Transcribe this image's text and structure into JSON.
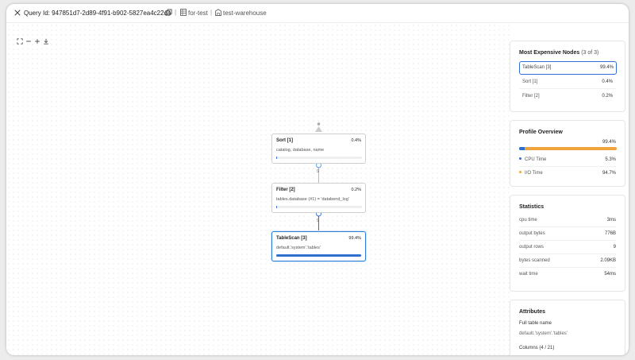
{
  "header": {
    "query_label": "Query Id: 947851d7-2d89-4f91-b902-5827ea4c22da",
    "sep": "|",
    "database": "for-test",
    "warehouse": "test-warehouse"
  },
  "toolbar": {
    "fit_icon": "fit-screen-icon",
    "zoom_out_icon": "minus-icon",
    "zoom_in_icon": "plus-icon",
    "download_icon": "download-icon"
  },
  "graph": {
    "nodes": [
      {
        "title": "Sort [1]",
        "percent": "0.4%",
        "detail": "catalog, database, name",
        "fill": 0.004
      },
      {
        "title": "Filter [2]",
        "percent": "0.2%",
        "detail": "tables.database (#1) = 'databend_log'",
        "fill": 0.002
      },
      {
        "title": "TableScan [3]",
        "percent": "99.4%",
        "detail": "default.'system'.'tables'",
        "fill": 0.994
      }
    ],
    "edge_labels": [
      "9",
      "9"
    ]
  },
  "expensive": {
    "title": "Most Expensive Nodes",
    "count": "(3 of 3)",
    "items": [
      {
        "label": "TableScan [3]",
        "value": "99.4%"
      },
      {
        "label": "Sort [1]",
        "value": "0.4%"
      },
      {
        "label": "Filter [2]",
        "value": "0.2%"
      }
    ]
  },
  "overview": {
    "title": "Profile Overview",
    "total": "99.4%",
    "cpu_fraction": 0.053,
    "io_fraction": 0.947,
    "cpu_label": "CPU Time",
    "cpu_value": "5.3%",
    "io_label": "I/O Time",
    "io_value": "94.7%",
    "cpu_color": "#2e6fd0",
    "io_color": "#f0a33a"
  },
  "statistics": {
    "title": "Statistics",
    "rows": [
      {
        "label": "cpu time",
        "value": "3ms"
      },
      {
        "label": "output bytes",
        "value": "776B"
      },
      {
        "label": "output rows",
        "value": "9"
      },
      {
        "label": "bytes scanned",
        "value": "2.09KB"
      },
      {
        "label": "wait time",
        "value": "54ms"
      }
    ]
  },
  "attributes": {
    "title": "Attributes",
    "full_table_label": "Full table name",
    "full_table_value": "default.'system'.'tables'",
    "columns_label": "Columns (4 / 21)"
  }
}
